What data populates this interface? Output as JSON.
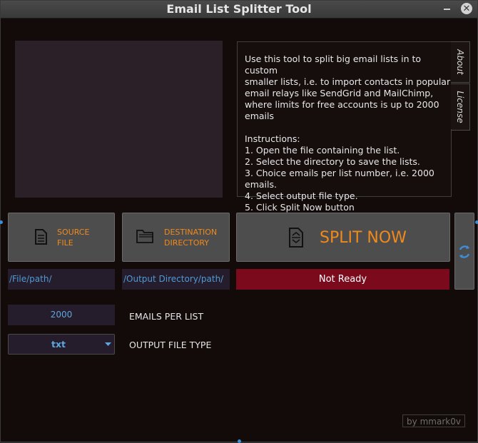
{
  "window": {
    "title": "Email List Splitter Tool",
    "close_glyph": "✕"
  },
  "info": {
    "text": "Use this tool to split big email lists in to custom\nsmaller lists, i.e. to import contacts in popular\nemail relays like SendGrid and MailChimp,\nwhere limits for free accounts is up to 2000 emails\n\nInstructions:\n1. Open the file containing the list.\n2. Select the directory to save the lists.\n3. Choice emails per list number, i.e. 2000 emails.\n4. Select output file type.\n5. Click Split Now button",
    "tabs": [
      "About",
      "License"
    ]
  },
  "buttons": {
    "source": {
      "label": "SOURCE\nFILE",
      "icon": "document-icon"
    },
    "destination": {
      "label": "DESTINATION\nDIRECTORY",
      "icon": "folder-icon"
    },
    "split": {
      "label": "SPLIT NOW",
      "icon": "split-file-icon"
    },
    "refresh": {
      "icon": "refresh-icon"
    }
  },
  "paths": {
    "source": "/File/path/",
    "destination": "/Output Directory/path/"
  },
  "status": {
    "text": "Not Ready",
    "color": "#7a0a1c"
  },
  "options": {
    "emails_per_list": "2000",
    "emails_per_list_label": "EMAILS PER LIST",
    "file_type": "txt",
    "file_type_label": "OUTPUT FILE TYPE"
  },
  "credit": "by mmark0v",
  "colors": {
    "accent": "#f08a1c",
    "link": "#4f9bd6",
    "background": "#130a0a"
  }
}
